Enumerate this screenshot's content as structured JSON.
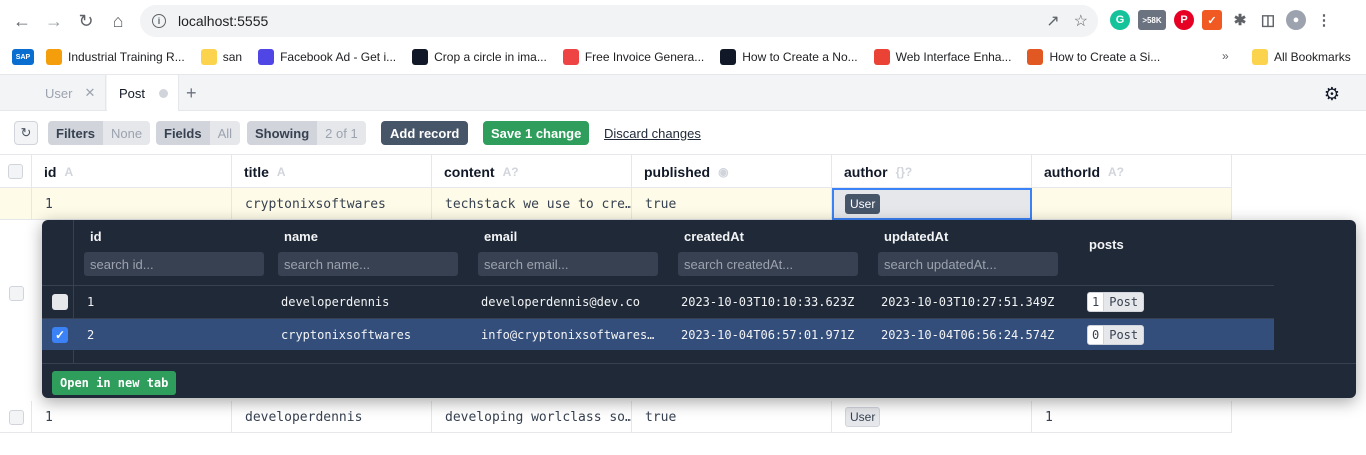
{
  "browser": {
    "url": "localhost:5555",
    "extension_badge": ">58K",
    "bookmarks": [
      {
        "label": "Industrial Training R...",
        "color": "#f59e0b"
      },
      {
        "label": "san",
        "color": "#fcd34d"
      },
      {
        "label": "Facebook Ad - Get i...",
        "color": "#4f46e5"
      },
      {
        "label": "Crop a circle in ima...",
        "color": "#111827"
      },
      {
        "label": "Free Invoice Genera...",
        "color": "#ef4444"
      },
      {
        "label": "How to Create a No...",
        "color": "#111827"
      },
      {
        "label": "Web Interface Enha...",
        "color": "#ea4335"
      },
      {
        "label": "How to Create a Si...",
        "color": "#e25822"
      }
    ],
    "all_bookmarks": "All Bookmarks"
  },
  "tabs": {
    "user": "User",
    "post": "Post"
  },
  "toolbar": {
    "filters": "Filters",
    "filters_val": "None",
    "fields": "Fields",
    "fields_val": "All",
    "showing": "Showing",
    "showing_val": "2 of 1",
    "add_record": "Add record",
    "save": "Save 1 change",
    "discard": "Discard changes"
  },
  "columns": [
    {
      "name": "id",
      "type": "A"
    },
    {
      "name": "title",
      "type": "A"
    },
    {
      "name": "content",
      "type": "A?"
    },
    {
      "name": "published",
      "type": "◉"
    },
    {
      "name": "author",
      "type": "{}?"
    },
    {
      "name": "authorId",
      "type": "A?"
    }
  ],
  "rows": [
    {
      "id": "1",
      "title": "cryptonixsoftwares",
      "content": "techstack we use to cre…",
      "published": "true",
      "author": "User",
      "authorId": ""
    },
    {
      "id": "1",
      "title": "developerdennis",
      "content": "developing worlclass so…",
      "published": "true",
      "author": "User",
      "authorId": "1"
    }
  ],
  "popup": {
    "columns": [
      {
        "name": "id",
        "placeholder": "search id..."
      },
      {
        "name": "name",
        "placeholder": "search name..."
      },
      {
        "name": "email",
        "placeholder": "search email..."
      },
      {
        "name": "createdAt",
        "placeholder": "search createdAt..."
      },
      {
        "name": "updatedAt",
        "placeholder": "search updatedAt..."
      },
      {
        "name": "posts",
        "placeholder": ""
      }
    ],
    "rows": [
      {
        "id": "1",
        "name": "developerdennis",
        "email": "developerdennis@dev.co",
        "createdAt": "2023-10-03T10:10:33.623Z",
        "updatedAt": "2023-10-03T10:27:51.349Z",
        "posts_count": "1",
        "posts_label": "Post",
        "checked": false
      },
      {
        "id": "2",
        "name": "cryptonixsoftwares",
        "email": "info@cryptonixsoftwares…",
        "createdAt": "2023-10-04T06:57:01.971Z",
        "updatedAt": "2023-10-04T06:56:24.574Z",
        "posts_count": "0",
        "posts_label": "Post",
        "checked": true
      }
    ],
    "open_new_tab": "Open in new tab"
  }
}
